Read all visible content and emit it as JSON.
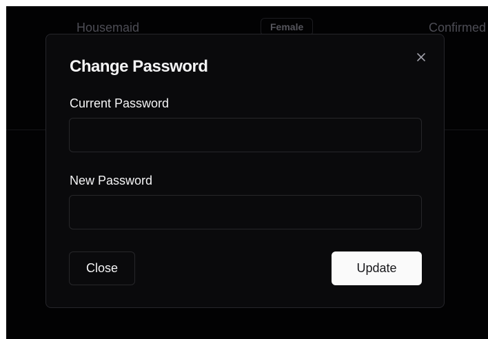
{
  "background_table": {
    "role": "Housemaid",
    "gender_badge": "Female",
    "status": "Confirmed"
  },
  "modal": {
    "title": "Change Password",
    "close_icon": "close-icon",
    "fields": {
      "current": {
        "label": "Current Password",
        "value": "",
        "placeholder": ""
      },
      "new": {
        "label": "New Password",
        "value": "",
        "placeholder": ""
      }
    },
    "buttons": {
      "close_label": "Close",
      "update_label": "Update"
    }
  },
  "colors": {
    "background": "#020203",
    "modal_bg": "#0a0a0c",
    "border": "#27272a",
    "text": "#f4f4f5",
    "muted_text": "#4d4d55",
    "primary_button_bg": "#fafafa",
    "primary_button_text": "#18181b"
  }
}
